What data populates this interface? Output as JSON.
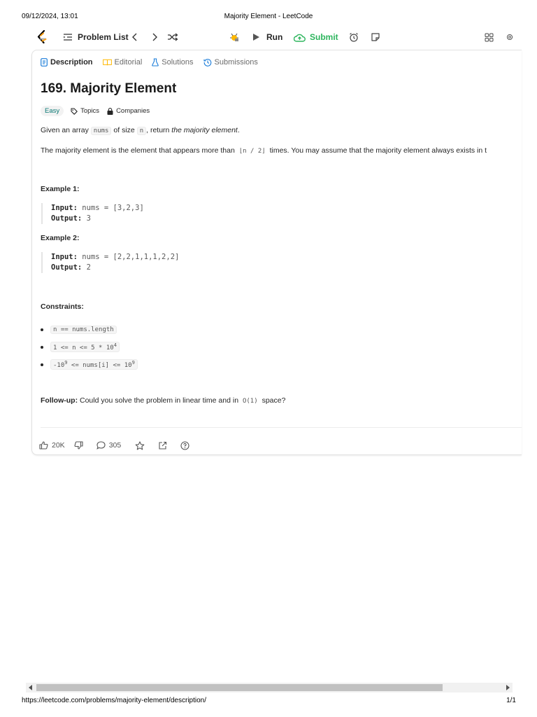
{
  "print_header": {
    "date": "09/12/2024, 13:01",
    "title": "Majority Element - LeetCode"
  },
  "print_footer": {
    "url": "https://leetcode.com/problems/majority-element/description/",
    "page": "1/1"
  },
  "toolbar": {
    "problem_list_label": "Problem List",
    "run_label": "Run",
    "submit_label": "Submit",
    "accent_submit": "#2db55d"
  },
  "tabs": [
    {
      "label": "Description",
      "icon": "description-icon",
      "active": true
    },
    {
      "label": "Editorial",
      "icon": "book-icon",
      "active": false
    },
    {
      "label": "Solutions",
      "icon": "flask-icon",
      "active": false
    },
    {
      "label": "Submissions",
      "icon": "history-icon",
      "active": false
    }
  ],
  "problem": {
    "title": "169. Majority Element",
    "difficulty": "Easy",
    "topics_label": "Topics",
    "companies_label": "Companies",
    "statement1": {
      "a": "Given an array",
      "code1": "nums",
      "b": "of size",
      "code2": "n",
      "c": ", return",
      "em": "the majority element",
      "d": "."
    },
    "statement2": {
      "a": "The majority element is the element that appears more than",
      "code": "⌊n / 2⌋",
      "b": "times. You may assume that the majority element always exists in t"
    },
    "examples": [
      {
        "heading": "Example 1:",
        "input_label": "Input:",
        "input": "nums = [3,2,3]",
        "output_label": "Output:",
        "output": "3"
      },
      {
        "heading": "Example 2:",
        "input_label": "Input:",
        "input": "nums = [2,2,1,1,1,2,2]",
        "output_label": "Output:",
        "output": "2"
      }
    ],
    "constraints_heading": "Constraints:",
    "constraints": [
      {
        "text": "n == nums.length"
      },
      {
        "pre": "1 <= n <= 5 * 10",
        "sup": "4",
        "post": ""
      },
      {
        "pre": "-10",
        "sup": "9",
        "post": " <= nums[i] <= 10",
        "sup2": "9"
      }
    ],
    "followup": {
      "label": "Follow-up:",
      "a": "Could you solve the problem in linear time and in",
      "code": "O(1)",
      "b": "space?"
    }
  },
  "footer_bar": {
    "likes": "20K",
    "comments": "305"
  }
}
